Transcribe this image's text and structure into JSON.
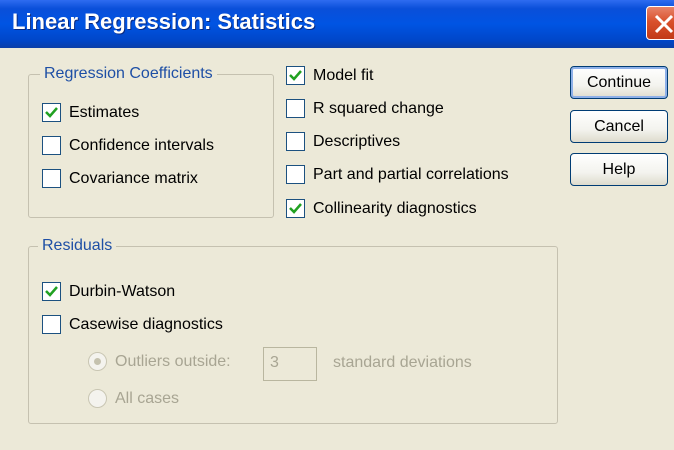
{
  "window": {
    "title": "Linear Regression: Statistics"
  },
  "coefficients": {
    "legend": "Regression Coefficients",
    "items": [
      {
        "label": "Estimates",
        "checked": true
      },
      {
        "label": "Confidence intervals",
        "checked": false
      },
      {
        "label": "Covariance matrix",
        "checked": false
      }
    ]
  },
  "options": {
    "items": [
      {
        "label": "Model fit",
        "checked": true
      },
      {
        "label": "R squared change",
        "checked": false
      },
      {
        "label": "Descriptives",
        "checked": false
      },
      {
        "label": "Part and partial correlations",
        "checked": false
      },
      {
        "label": "Collinearity diagnostics",
        "checked": true
      }
    ]
  },
  "residuals": {
    "legend": "Residuals",
    "durbin_watson": {
      "label": "Durbin-Watson",
      "checked": true
    },
    "casewise": {
      "label": "Casewise diagnostics",
      "checked": false
    },
    "outliers": {
      "label": "Outliers outside:",
      "selected": true,
      "enabled": false
    },
    "stddev_value": "3",
    "stddev_suffix": "standard deviations",
    "all_cases": {
      "label": "All cases",
      "selected": false,
      "enabled": false
    }
  },
  "buttons": {
    "continue": "Continue",
    "cancel": "Cancel",
    "help": "Help"
  },
  "colors": {
    "title_bar": "#0054e3",
    "dialog_bg": "#ece9d8",
    "legend_text": "#1e4fa5",
    "disabled_text": "#a8a593"
  }
}
